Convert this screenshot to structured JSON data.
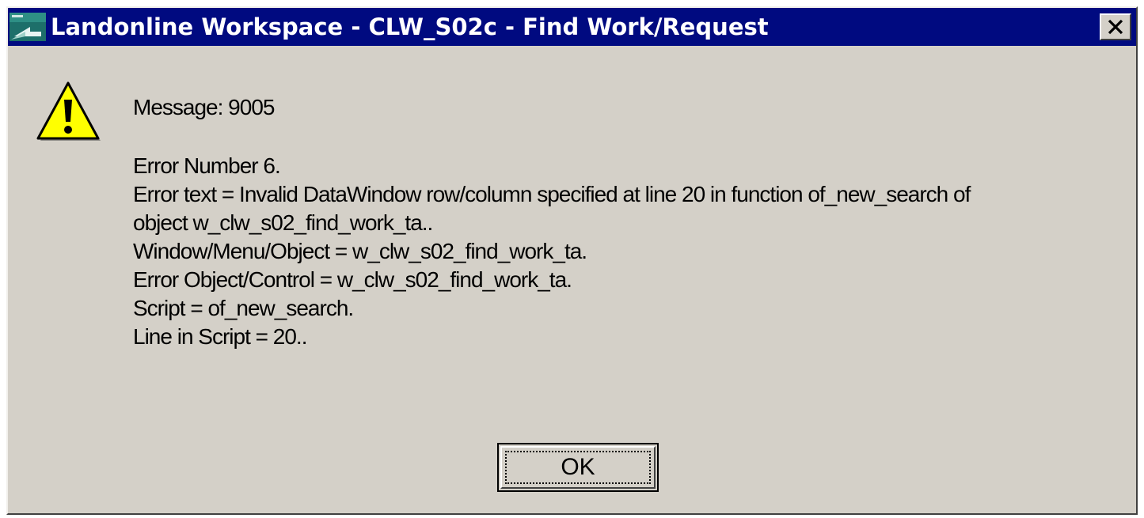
{
  "window": {
    "title": "Landonline Workspace - CLW_S02c - Find Work/Request",
    "app_icon": "landonline-app-icon",
    "close_icon": "close-icon",
    "title_bar_color": "#000a80",
    "background_color": "#d4d0c8"
  },
  "dialog": {
    "icon": "warning-icon",
    "message_header": "Message: 9005",
    "lines": [
      "Error Number 6.",
      "Error text = Invalid DataWindow row/column specified at line 20 in function of_new_search of",
      "object w_clw_s02_find_work_ta..",
      "Window/Menu/Object = w_clw_s02_find_work_ta.",
      "Error Object/Control = w_clw_s02_find_work_ta.",
      "Script = of_new_search.",
      "Line in Script = 20.."
    ],
    "ok_label": "OK"
  }
}
